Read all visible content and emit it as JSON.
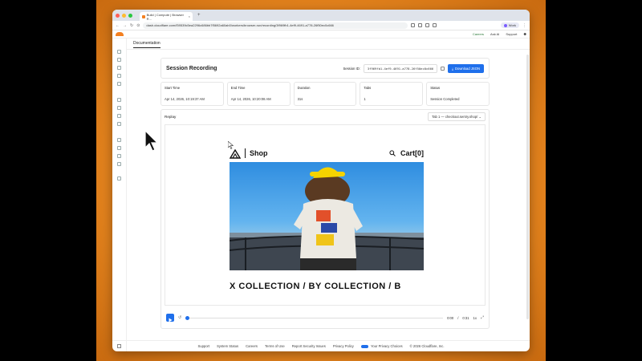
{
  "browser": {
    "tab_title": "Build | Compute | Browser R…",
    "url": "dash.cloudflare.com/f39539c5ea2296c686bb7f5692a60ab0/workers/browser-run/recording/3f969fb1-4ef9-4691-a778-26f50ec0c666",
    "profile": "Work"
  },
  "app_header": {
    "careers": "Careers",
    "ask_ai": "Ask AI",
    "support": "Support"
  },
  "subnav": {
    "documentation": "Documentation"
  },
  "session": {
    "title": "Session Recording",
    "session_id_label": "Session ID:",
    "session_id_value": "3f969fb1-4ef9-4691-a778-26f50ec0c666",
    "download_label": "Download JSON"
  },
  "stats": [
    {
      "label": "Start Time",
      "value": "Apr 14, 2026, 10:19:37 AM"
    },
    {
      "label": "End Time",
      "value": "Apr 14, 2026, 10:20:08 AM"
    },
    {
      "label": "Duration",
      "value": "31s"
    },
    {
      "label": "Tabs",
      "value": "1"
    },
    {
      "label": "Status",
      "value": "Session Completed"
    }
  ],
  "replay": {
    "label": "Replay",
    "tab_select": "Tab 1 — checkout.sentry.shop/",
    "shop_name": "Shop",
    "cart": "Cart[0]",
    "marquee": "X COLLECTION / BY COLLECTION / B",
    "time_current": "0:00",
    "time_sep": "/",
    "time_total": "0:31",
    "speed": "1x"
  },
  "footer": {
    "links": [
      "Support",
      "System Status",
      "Careers",
      "Terms of Use",
      "Report Security Issues",
      "Privacy Policy"
    ],
    "privacy_choices": "Your Privacy Choices",
    "copyright": "© 2026 Cloudflare, Inc."
  },
  "colors": {
    "accent": "#1f6feb",
    "cloudflare_orange": "#f38020",
    "backdrop": "#e0801c"
  }
}
